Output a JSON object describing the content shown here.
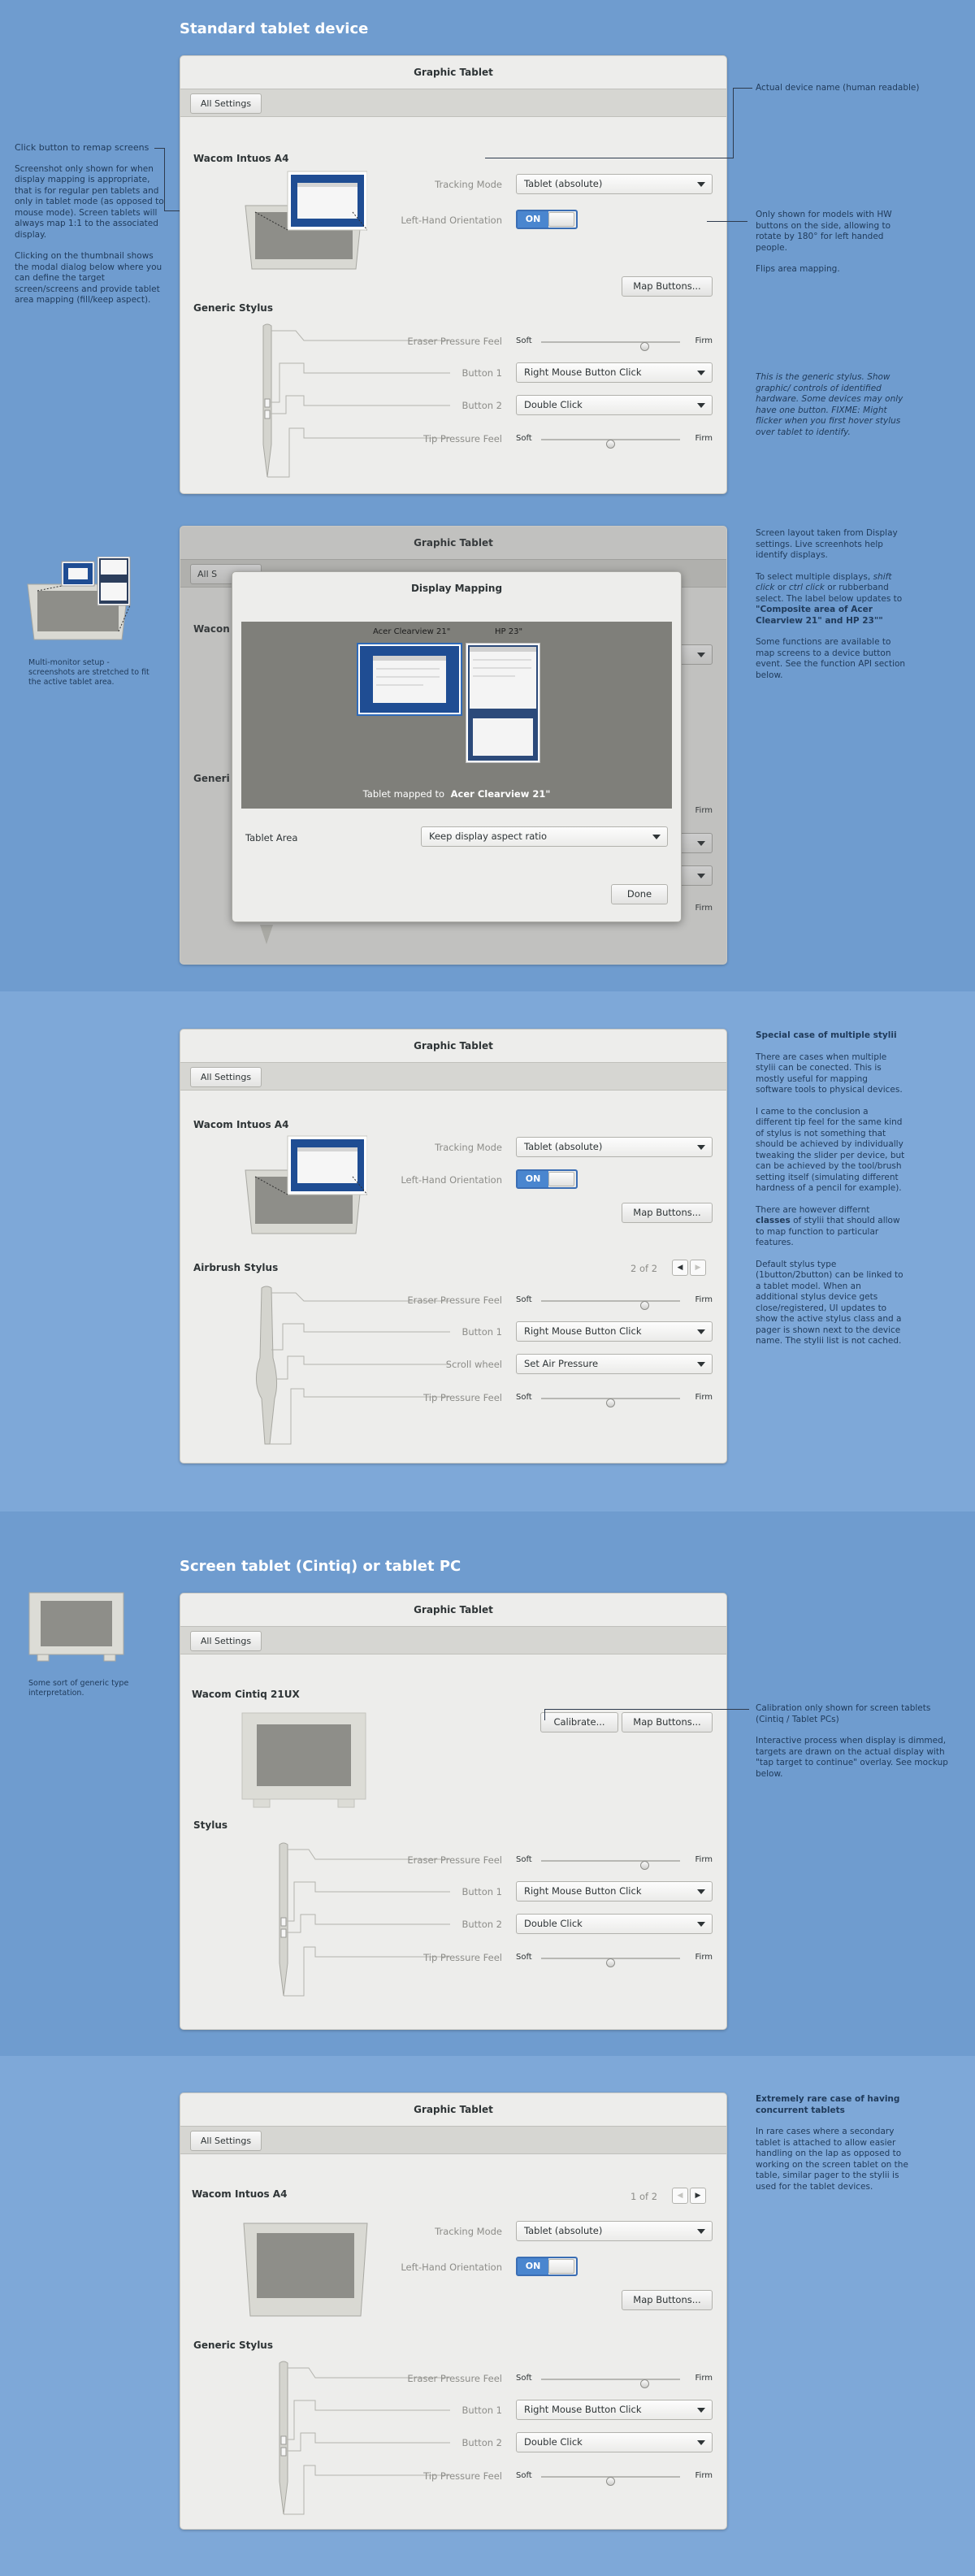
{
  "sections": {
    "standard": {
      "title": "Standard tablet device",
      "window": {
        "title": "Graphic Tablet",
        "all_settings": "All Settings",
        "device_name": "Wacom Intuos A4",
        "tracking_mode_label": "Tracking Mode",
        "tracking_mode_value": "Tablet (absolute)",
        "left_hand_label": "Left-Hand Orientation",
        "switch_on": "ON",
        "map_buttons": "Map Buttons...",
        "stylus_name": "Generic Stylus",
        "eraser_label": "Eraser Pressure Feel",
        "button1_label": "Button 1",
        "button1_value": "Right Mouse Button Click",
        "button2_label": "Button 2",
        "button2_value": "Double Click",
        "tip_label": "Tip Pressure Feel",
        "soft": "Soft",
        "firm": "Firm",
        "eraser_level": 0.75,
        "tip_level": 0.5
      },
      "left_note": {
        "heading": "Click button to remap screens",
        "p1": "Screenshot only shown for when display mapping is appropriate, that is for regular pen tablets and only in tablet mode (as opposed to mouse mode). Screen tablets will always map 1:1 to the associated display.",
        "p2": "Clicking on the thumbnail shows the modal dialog below where you can define the target screen/screens and provide tablet area mapping (fill/keep aspect)."
      },
      "right_notes": {
        "device_name": "Actual device name (human readable)",
        "hw_buttons": "Only shown for models with HW buttons on the side, allowing to rotate by 180° for left handed people.",
        "flips": "Flips area mapping.",
        "generic_stylus": "This is the generic stylus. Show graphic/ controls of identified hardware. Some devices may only have one button. FIXME: Might flicker when you first hover stylus over tablet to identify."
      }
    },
    "mapping": {
      "window_title": "Graphic Tablet",
      "all_settings_partial": "All S",
      "device_partial": "Wacon",
      "generic_partial": "Generi",
      "firm": "Firm",
      "dialog": {
        "title": "Display Mapping",
        "monitor1": "Acer Clearview 21\"",
        "monitor2": "HP 23\"",
        "mapped_prefix": "Tablet mapped to",
        "mapped_target": "Acer Clearview 21\"",
        "tablet_area_label": "Tablet Area",
        "tablet_area_value": "Keep display aspect ratio",
        "done": "Done"
      },
      "left_note": "Multi-monitor setup - screenshots are stretched to fit the active tablet area.",
      "right_note": {
        "p1": "Screen layout taken from Display settings. Live screenhots help identify displays.",
        "p2a": "To select multiple displays,",
        "p2b": "shift click",
        "p2c": "or",
        "p2d": "ctrl click",
        "p2e": "or rubberband select. The label below updates to",
        "p2f": "\"Composite area of Acer Clearview 21\" and HP 23\"\"",
        "p3": "Some functions are available to map screens to a device button event. See the function API section below."
      }
    },
    "multi_stylus": {
      "window": {
        "title": "Graphic Tablet",
        "all_settings": "All Settings",
        "device_name": "Wacom Intuos A4",
        "tracking_mode_label": "Tracking Mode",
        "tracking_mode_value": "Tablet (absolute)",
        "left_hand_label": "Left-Hand Orientation",
        "switch_on": "ON",
        "map_buttons": "Map Buttons...",
        "stylus_name": "Airbrush Stylus",
        "pager": "2 of 2",
        "eraser_label": "Eraser Pressure Feel",
        "button1_label": "Button 1",
        "button1_value": "Right Mouse Button Click",
        "scroll_label": "Scroll wheel",
        "scroll_value": "Set Air Pressure",
        "tip_label": "Tip Pressure Feel",
        "soft": "Soft",
        "firm": "Firm",
        "eraser_level": 0.75,
        "tip_level": 0.5
      },
      "right_note": {
        "heading": "Special case of multiple stylii",
        "p1": "There are cases when multiple stylii can be conected. This is mostly useful for mapping software tools to physical devices.",
        "p2": "I came to the conclusion a different tip feel for the same kind of stylus is not something that should be achieved by individually tweaking the slider per device, but can be achieved by the tool/brush setting itself (simulating different hardness of a pencil for example).",
        "p3a": "There are however differnt",
        "p3b": "classes",
        "p3c": "of stylii that should allow to map function to particular features.",
        "p4": "Default stylus type (1button/2button) can be linked to a tablet model. When an additional stylus device gets close/registered, UI updates to show the active stylus class and a pager is shown next to the device name. The stylii list is not cached."
      }
    },
    "cintiq": {
      "title": "Screen tablet (Cintiq) or tablet PC",
      "window": {
        "title": "Graphic Tablet",
        "all_settings": "All Settings",
        "device_name": "Wacom Cintiq 21UX",
        "calibrate": "Calibrate...",
        "map_buttons": "Map Buttons...",
        "stylus_name": "Stylus",
        "eraser_label": "Eraser Pressure Feel",
        "button1_label": "Button 1",
        "button1_value": "Right Mouse Button Click",
        "button2_label": "Button 2",
        "button2_value": "Double Click",
        "tip_label": "Tip Pressure Feel",
        "soft": "Soft",
        "firm": "Firm",
        "eraser_level": 0.75,
        "tip_level": 0.5
      },
      "left_note": "Some sort of generic type interpretation.",
      "right_note": {
        "p1": "Calibration only shown for screen tablets (Cintiq / Tablet PCs)",
        "p2": "Interactive process when display is dimmed, targets are drawn on the actual display with \"tap target to continue\" overlay. See mockup below."
      }
    },
    "concurrent": {
      "window": {
        "title": "Graphic Tablet",
        "all_settings": "All Settings",
        "device_name": "Wacom Intuos A4",
        "pager": "1 of 2",
        "tracking_mode_label": "Tracking Mode",
        "tracking_mode_value": "Tablet (absolute)",
        "left_hand_label": "Left-Hand Orientation",
        "switch_on": "ON",
        "map_buttons": "Map Buttons...",
        "stylus_name": "Generic Stylus",
        "eraser_label": "Eraser Pressure Feel",
        "button1_label": "Button 1",
        "button1_value": "Right Mouse Button Click",
        "button2_label": "Button 2",
        "button2_value": "Double Click",
        "tip_label": "Tip Pressure Feel",
        "soft": "Soft",
        "firm": "Firm",
        "eraser_level": 0.75,
        "tip_level": 0.5
      },
      "right_note": {
        "heading": "Extremely rare case of having concurrent tablets",
        "p1": "In rare cases where a secondary tablet is attached to allow easier handling on the lap as opposed to working on the screen tablet on the table, similar pager to the stylii is used for the tablet devices."
      }
    }
  },
  "colors": {
    "background": "#6f9ccf",
    "band_light": "#7ea8d8",
    "accent": "#4a86cf",
    "window": "#ededeb"
  }
}
